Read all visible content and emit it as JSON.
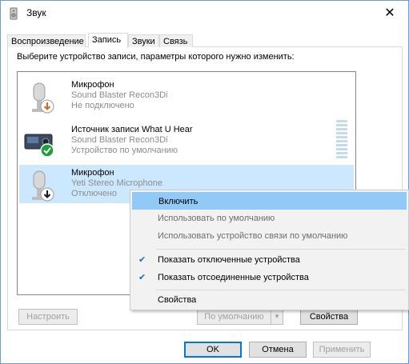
{
  "window": {
    "title": "Звук",
    "icon": "speaker-icon",
    "close_glyph": "✕"
  },
  "tabs": [
    {
      "label": "Воспроизведение"
    },
    {
      "label": "Запись",
      "active": true
    },
    {
      "label": "Звуки"
    },
    {
      "label": "Связь"
    }
  ],
  "instruction": "Выберите устройство записи, параметры которого нужно изменить:",
  "devices": [
    {
      "name": "Микрофон",
      "driver": "Sound Blaster Recon3Di",
      "status": "Не подключено",
      "icon": "microphone-icon",
      "badge": "down-arrow-badge"
    },
    {
      "name": "Источник записи What U Hear",
      "driver": "Sound Blaster Recon3Di",
      "status": "Устройство по умолчанию",
      "icon": "sound-card-icon",
      "badge": "checkmark-badge"
    },
    {
      "name": "Микрофон",
      "driver": "Yeti Stereo Microphone",
      "status": "Отключено",
      "icon": "microphone-icon",
      "badge": "down-arrow-badge",
      "selected": true
    }
  ],
  "buttons": {
    "configure": "Настроить",
    "set_default": "По умолчанию",
    "properties": "Свойства",
    "ok": "OK",
    "cancel": "Отмена",
    "apply": "Применить"
  },
  "context_menu": {
    "enable": "Включить",
    "use_default": "Использовать по умолчанию",
    "use_comm_default": "Использовать устройство связи по умолчанию",
    "show_disabled": "Показать отключенные устройства",
    "show_disconnected": "Показать отсоединенные устройства",
    "properties": "Свойства",
    "check_glyph": "✔"
  },
  "colors": {
    "accent": "#0078d7",
    "selection": "#cce8ff",
    "menu_highlight": "#91c9f7",
    "checkmark_badge": "#1f9e3a",
    "down_badge_orange": "#d36b1f"
  }
}
